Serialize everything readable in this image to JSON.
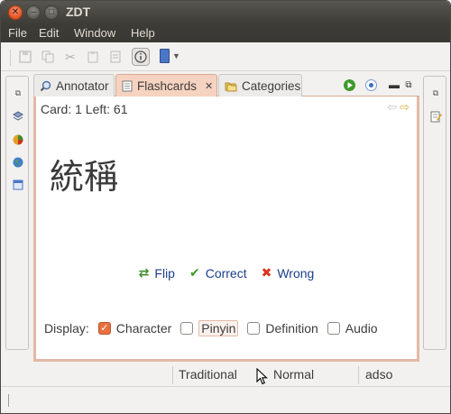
{
  "window": {
    "title": "ZDT"
  },
  "menu": {
    "items": [
      "File",
      "Edit",
      "Window",
      "Help"
    ]
  },
  "toolbar": {
    "buttons": [
      {
        "icon": "save-icon",
        "enabled": false
      },
      {
        "icon": "copy-icon",
        "enabled": false
      },
      {
        "icon": "cut-icon",
        "enabled": false
      },
      {
        "icon": "paste-icon",
        "enabled": false
      },
      {
        "icon": "clipboard-icon",
        "enabled": false
      },
      {
        "icon": "info-icon",
        "enabled": true,
        "pressed": true
      },
      {
        "icon": "dictionary-book-icon",
        "enabled": true,
        "dropdown": true
      }
    ]
  },
  "tabs": [
    {
      "label": "Annotator",
      "icon": "magnifier-icon",
      "active": false
    },
    {
      "label": "Flashcards",
      "icon": "document-icon",
      "active": true,
      "closable": true,
      "close_glyph": "✕"
    },
    {
      "label": "Categories",
      "icon": "folders-icon",
      "active": false
    }
  ],
  "card": {
    "info": "Card: 1 Left: 61",
    "character": "統稱"
  },
  "actions": [
    {
      "label": "Flip",
      "icon": "flip-icon"
    },
    {
      "label": "Correct",
      "icon": "checkmark-icon"
    },
    {
      "label": "Wrong",
      "icon": "cross-icon"
    }
  ],
  "display": {
    "label": "Display:",
    "options": [
      {
        "label": "Character",
        "checked": true
      },
      {
        "label": "Pinyin",
        "checked": false,
        "focused": true
      },
      {
        "label": "Definition",
        "checked": false
      },
      {
        "label": "Audio",
        "checked": false
      }
    ]
  },
  "status": {
    "cells": [
      "Traditional",
      "Normal",
      "adso"
    ]
  },
  "colors": {
    "accent": "#e9703f",
    "link": "#1c3f8c",
    "tab_active": "#f6d3c1",
    "panel_border": "#e4b8a6"
  }
}
